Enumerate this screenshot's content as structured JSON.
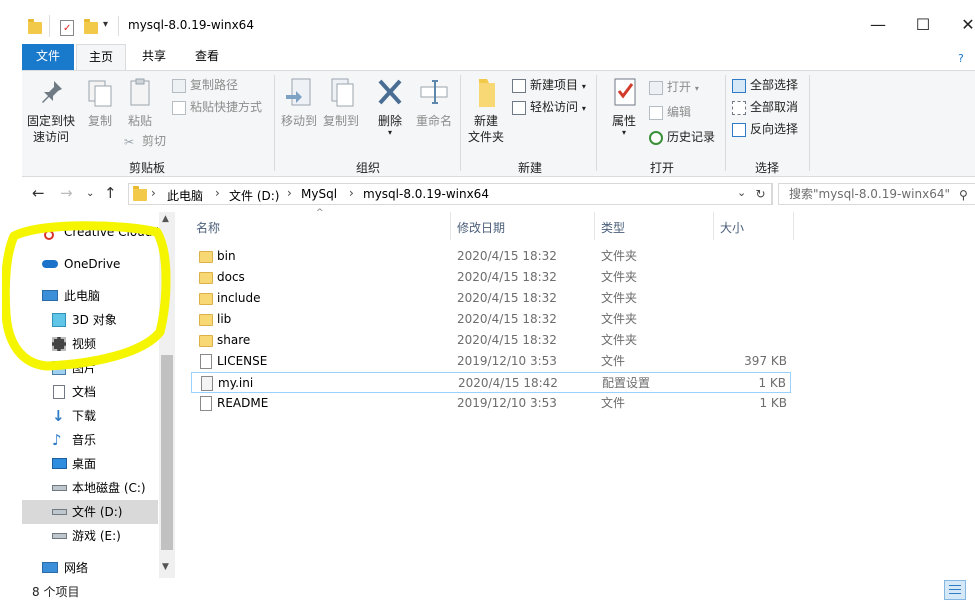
{
  "window": {
    "title": "mysql-8.0.19-winx64",
    "controls": {
      "minimize": "—",
      "maximize": "☐",
      "close": "✕"
    }
  },
  "ribbon_tabs": [
    "文件",
    "主页",
    "共享",
    "查看"
  ],
  "ribbon": {
    "clipboard": {
      "pin_label": [
        "固定到快",
        "速访问"
      ],
      "copy_label": "复制",
      "paste_label": "粘贴",
      "copy_path": "复制路径",
      "paste_shortcut": "粘贴快捷方式",
      "cut": "剪切",
      "group_label": "剪贴板"
    },
    "organize": {
      "move_to": "移动到",
      "copy_to": "复制到",
      "delete": "删除",
      "rename": "重命名",
      "group_label": "组织"
    },
    "new": {
      "new_folder": [
        "新建",
        "文件夹"
      ],
      "new_item": "新建项目",
      "easy_access": "轻松访问",
      "group_label": "新建"
    },
    "open": {
      "properties": "属性",
      "open": "打开",
      "edit": "编辑",
      "history": "历史记录",
      "group_label": "打开"
    },
    "select": {
      "select_all": "全部选择",
      "select_none": "全部取消",
      "invert": "反向选择",
      "group_label": "选择"
    }
  },
  "address": {
    "crumbs": [
      "此电脑",
      "文件 (D:)",
      "MySql",
      "mysql-8.0.19-winx64"
    ],
    "search_placeholder": "搜索\"mysql-8.0.19-winx64\""
  },
  "nav": {
    "items": [
      {
        "label": "Creative Cloud F",
        "icon": "creative-cloud-icon"
      },
      {
        "label": "OneDrive",
        "icon": "onedrive-icon"
      },
      {
        "label": "此电脑",
        "icon": "computer-icon"
      },
      {
        "label": "3D 对象",
        "icon": "3d-objects-icon"
      },
      {
        "label": "视频",
        "icon": "video-icon"
      },
      {
        "label": "图片",
        "icon": "pictures-icon"
      },
      {
        "label": "文档",
        "icon": "documents-icon"
      },
      {
        "label": "下载",
        "icon": "downloads-icon"
      },
      {
        "label": "音乐",
        "icon": "music-icon"
      },
      {
        "label": "桌面",
        "icon": "desktop-icon"
      },
      {
        "label": "本地磁盘 (C:)",
        "icon": "drive-icon"
      },
      {
        "label": "文件 (D:)",
        "icon": "drive-icon"
      },
      {
        "label": "游戏 (E:)",
        "icon": "drive-icon"
      },
      {
        "label": "网络",
        "icon": "network-icon"
      }
    ]
  },
  "columns": [
    "名称",
    "修改日期",
    "类型",
    "大小"
  ],
  "files": [
    {
      "name": "bin",
      "date": "2020/4/15 18:32",
      "type": "文件夹",
      "size": "",
      "kind": "folder"
    },
    {
      "name": "docs",
      "date": "2020/4/15 18:32",
      "type": "文件夹",
      "size": "",
      "kind": "folder"
    },
    {
      "name": "include",
      "date": "2020/4/15 18:32",
      "type": "文件夹",
      "size": "",
      "kind": "folder"
    },
    {
      "name": "lib",
      "date": "2020/4/15 18:32",
      "type": "文件夹",
      "size": "",
      "kind": "folder"
    },
    {
      "name": "share",
      "date": "2020/4/15 18:32",
      "type": "文件夹",
      "size": "",
      "kind": "folder"
    },
    {
      "name": "LICENSE",
      "date": "2019/12/10 3:53",
      "type": "文件",
      "size": "397 KB",
      "kind": "file"
    },
    {
      "name": "my.ini",
      "date": "2020/4/15 18:42",
      "type": "配置设置",
      "size": "1 KB",
      "kind": "ini"
    },
    {
      "name": "README",
      "date": "2019/12/10 3:53",
      "type": "文件",
      "size": "1 KB",
      "kind": "file"
    }
  ],
  "status": {
    "item_count": "8 个项目"
  },
  "colors": {
    "accent": "#1979ca",
    "highlight": "#f5f500",
    "folder": "#f8d775"
  }
}
